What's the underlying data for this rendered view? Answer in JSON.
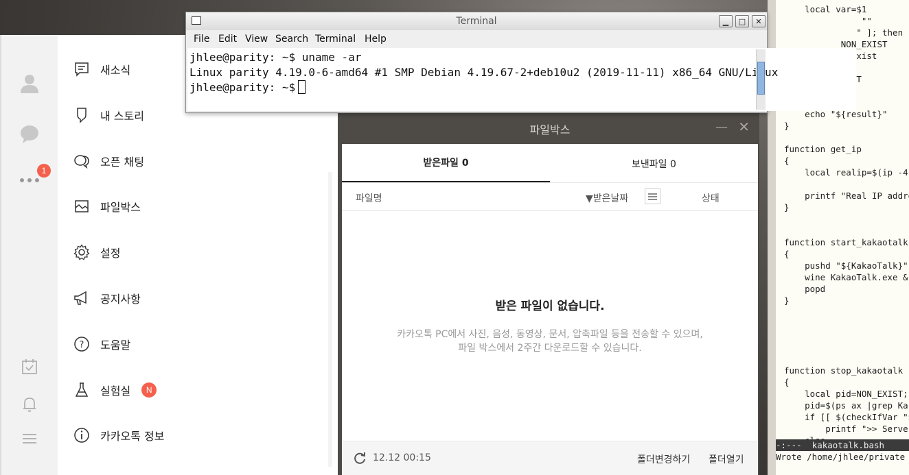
{
  "terminal": {
    "title": "Terminal",
    "menu": [
      "File",
      "Edit",
      "View",
      "Search",
      "Terminal",
      "Help"
    ],
    "lines": [
      "jhlee@parity: ~$ uname -ar",
      "Linux parity 4.19.0-6-amd64 #1 SMP Debian 4.19.67-2+deb10u2 (2019-11-11) x86_64 GNU/Linux",
      "jhlee@parity: ~$"
    ]
  },
  "kakao": {
    "rail_badge": "1",
    "menu": [
      {
        "label": "새소식",
        "icon": "news-icon"
      },
      {
        "label": "내 스토리",
        "icon": "story-icon"
      },
      {
        "label": "오픈 채팅",
        "icon": "open-chat-icon"
      },
      {
        "label": "파일박스",
        "icon": "filebox-icon"
      },
      {
        "label": "설정",
        "icon": "settings-icon"
      },
      {
        "label": "공지사항",
        "icon": "megaphone-icon"
      },
      {
        "label": "도움말",
        "icon": "help-icon"
      },
      {
        "label": "실험실",
        "icon": "flask-icon",
        "badge": "N"
      },
      {
        "label": "카카오톡 정보",
        "icon": "info-icon"
      }
    ]
  },
  "filebox": {
    "title": "파일박스",
    "tabs": {
      "received": "받은파일 0",
      "sent": "보낸파일 0"
    },
    "columns": {
      "name": "파일명",
      "date": "▼받은날짜",
      "status": "상태"
    },
    "empty_title": "받은 파일이 없습니다.",
    "empty_desc_1": "카카오톡 PC에서 사진, 음성, 동영상, 문서, 압축파일 등을 전송할 수 있으며,",
    "empty_desc_2": "파일 박스에서 2주간 다운로드할 수 있습니다.",
    "footer": {
      "time": "12.12 00:15",
      "change_folder": "폴더변경하기",
      "open_folder": "폴더열기"
    }
  },
  "editor": {
    "lines": [
      "    local var=$1",
      "               \"\"",
      "              \" ]; then",
      "           NON_EXIST",
      "             exist",
      "",
      "          EXIST",
      "",
      "",
      "    echo \"${result}\"",
      "}",
      "",
      "function get_ip",
      "{",
      "    local realip=$(ip -4",
      "",
      "    printf \"Real IP addre",
      "}",
      "",
      "",
      "function start_kakaotalk",
      "{",
      "    pushd \"${KakaoTalk}\"",
      "    wine KakaoTalk.exe &",
      "    popd",
      "}",
      "",
      "",
      "",
      "",
      "",
      "function stop_kakaotalk",
      "{",
      "    local pid=NON_EXIST;",
      "    pid=$(ps ax |grep Kak",
      "    if [[ $(checkIfVar \"$",
      "        printf \">> Serve",
      "    else"
    ],
    "modeline": "-:---  kakaotalk.bash",
    "minibuffer": "Wrote /home/jhlee/private"
  }
}
